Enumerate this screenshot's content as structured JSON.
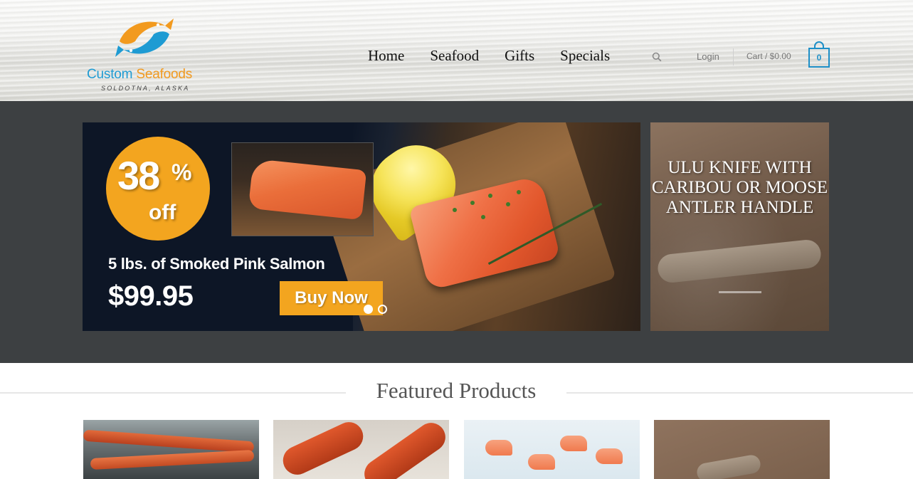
{
  "logo": {
    "name_part1": "Custom",
    "name_part2": "Seafoods",
    "location": "SOLDOTNA, ALASKA",
    "icon": "two-fish-icon",
    "colors": {
      "blue": "#1e9bd3",
      "orange": "#f29a1f"
    }
  },
  "nav": {
    "items": [
      {
        "label": "Home"
      },
      {
        "label": "Seafood"
      },
      {
        "label": "Gifts"
      },
      {
        "label": "Specials"
      }
    ],
    "search_icon": "search-icon"
  },
  "account": {
    "login_label": "Login",
    "cart_label": "Cart / $0.00",
    "cart_count": "0",
    "cart_icon": "shopping-bag-icon",
    "accent_color": "#1e8fc7"
  },
  "slider": {
    "discount_number": "38",
    "discount_percent": "%",
    "discount_off": "off",
    "title": "5 lbs. of Smoked Pink Salmon",
    "price": "$99.95",
    "cta_label": "Buy Now",
    "accent_color": "#f3a51f",
    "slide_count": 2,
    "active_slide": 1
  },
  "side_promo": {
    "title": "ULU KNIFE WITH CARIBOU OR MOOSE ANTLER HANDLE"
  },
  "featured": {
    "title": "Featured Products",
    "cards": [
      {
        "image": "king-crab-legs-photo"
      },
      {
        "image": "snow-crab-legs-photo"
      },
      {
        "image": "shrimp-photo"
      },
      {
        "image": "ulu-knife-antler-photo"
      }
    ]
  }
}
